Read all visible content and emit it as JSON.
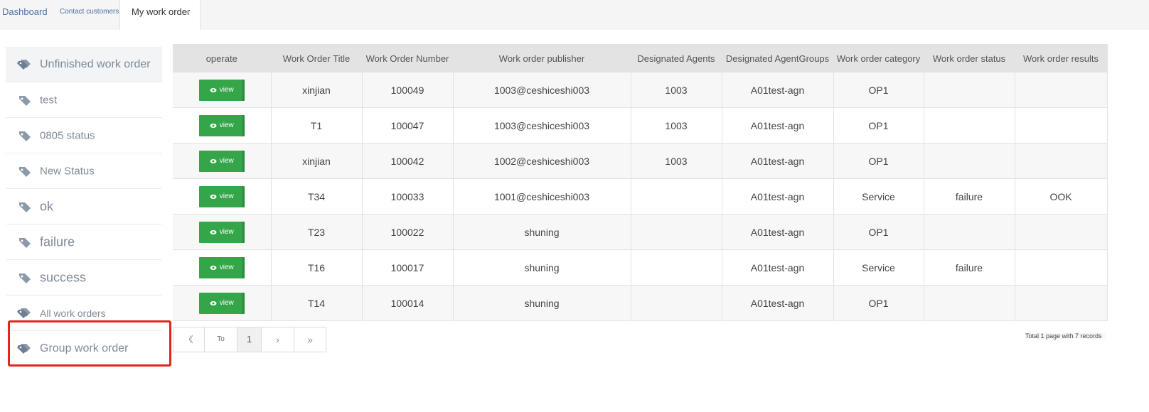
{
  "tabs": {
    "dashboard": "Dashboard",
    "contact": "Contact customers",
    "my_work_order": "My work order",
    "close_glyph": "×"
  },
  "sidebar": {
    "items": [
      {
        "label": "Unfinished work order",
        "icon": "double-tag-icon"
      },
      {
        "label": "test",
        "icon": "tag-icon"
      },
      {
        "label": "0805 status",
        "icon": "tag-icon"
      },
      {
        "label": "New Status",
        "icon": "tag-icon"
      },
      {
        "label": "ok",
        "icon": "tag-icon"
      },
      {
        "label": "failure",
        "icon": "tag-icon"
      },
      {
        "label": "success",
        "icon": "tag-icon"
      },
      {
        "label": "All work orders",
        "icon": "double-tag-icon"
      },
      {
        "label": "Group work order",
        "icon": "double-tag-icon"
      }
    ]
  },
  "table": {
    "headers": [
      "operate",
      "Work Order Title",
      "Work Order Number",
      "Work order publisher",
      "Designated Agents",
      "Designated AgentGroups",
      "Work order category",
      "Work order status",
      "Work order results"
    ],
    "view_label": "view",
    "rows": [
      {
        "title": "xinjian",
        "number": "100049",
        "publisher": "1003@ceshiceshi003",
        "agent": "1003",
        "group": "A01test-agn",
        "category": "OP1",
        "status": "",
        "result": ""
      },
      {
        "title": "T1",
        "number": "100047",
        "publisher": "1003@ceshiceshi003",
        "agent": "1003",
        "group": "A01test-agn",
        "category": "OP1",
        "status": "",
        "result": ""
      },
      {
        "title": "xinjian",
        "number": "100042",
        "publisher": "1002@ceshiceshi003",
        "agent": "1003",
        "group": "A01test-agn",
        "category": "OP1",
        "status": "",
        "result": ""
      },
      {
        "title": "T34",
        "number": "100033",
        "publisher": "1001@ceshiceshi003",
        "agent": "",
        "group": "A01test-agn",
        "category": "Service",
        "status": "failure",
        "result": "OOK"
      },
      {
        "title": "T23",
        "number": "100022",
        "publisher": "shuning",
        "agent": "",
        "group": "A01test-agn",
        "category": "OP1",
        "status": "",
        "result": ""
      },
      {
        "title": "T16",
        "number": "100017",
        "publisher": "shuning",
        "agent": "",
        "group": "A01test-agn",
        "category": "Service",
        "status": "failure",
        "result": ""
      },
      {
        "title": "T14",
        "number": "100014",
        "publisher": "shuning",
        "agent": "",
        "group": "A01test-agn",
        "category": "OP1",
        "status": "",
        "result": ""
      }
    ]
  },
  "pagination": {
    "first": "《",
    "to": "To",
    "current_page": "1",
    "next": "›",
    "last": "»",
    "summary": "Total 1 page with 7 records"
  },
  "colors": {
    "view_button": "#35a549",
    "highlight_box": "#e32420",
    "header_bg": "#e3e3e3"
  }
}
